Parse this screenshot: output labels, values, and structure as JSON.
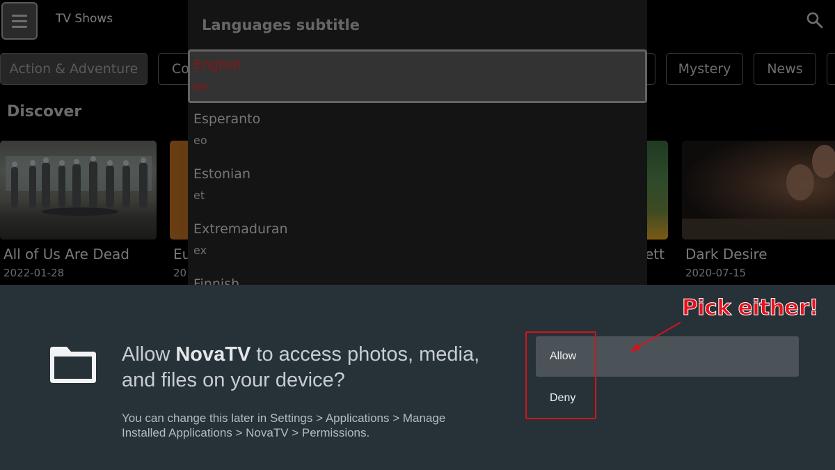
{
  "app": {
    "title": "TV Shows",
    "menu_icon": "hamburger-icon",
    "search_icon": "search-icon"
  },
  "genres": [
    {
      "label": "Action & Adventure",
      "selected": true
    },
    {
      "label": "Comedy",
      "selected": false
    },
    {
      "label": "",
      "selected": false
    },
    {
      "label": "Mystery",
      "selected": false
    },
    {
      "label": "News",
      "selected": false
    },
    {
      "label": "",
      "selected": false
    }
  ],
  "discover": {
    "title": "Discover",
    "cards": [
      {
        "title": "All of Us Are Dead",
        "date": "2022-01-28"
      },
      {
        "title": "Eu",
        "date": "20"
      },
      {
        "title": "ett",
        "date": ""
      },
      {
        "title": "Dark Desire",
        "date": "2020-07-15"
      }
    ]
  },
  "language_dialog": {
    "title": "Languages subtitle",
    "items": [
      {
        "name": "English",
        "code": "en",
        "selected": true
      },
      {
        "name": "Esperanto",
        "code": "eo",
        "selected": false
      },
      {
        "name": "Estonian",
        "code": "et",
        "selected": false
      },
      {
        "name": "Extremaduran",
        "code": "ex",
        "selected": false
      },
      {
        "name": "Finnish",
        "code": "",
        "selected": false
      }
    ],
    "selected_color": "#8a1414"
  },
  "permission": {
    "icon": "folder-icon",
    "question_prefix": "Allow ",
    "app_name": "NovaTV",
    "question_suffix": " to access photos, media, and files on your device?",
    "note": "You can change this later in Settings > Applications > Manage Installed Applications > NovaTV > Permissions.",
    "allow_label": "Allow",
    "deny_label": "Deny",
    "focused": "Allow"
  },
  "annotation": {
    "text": "Pick either!",
    "color": "#e8121c"
  }
}
